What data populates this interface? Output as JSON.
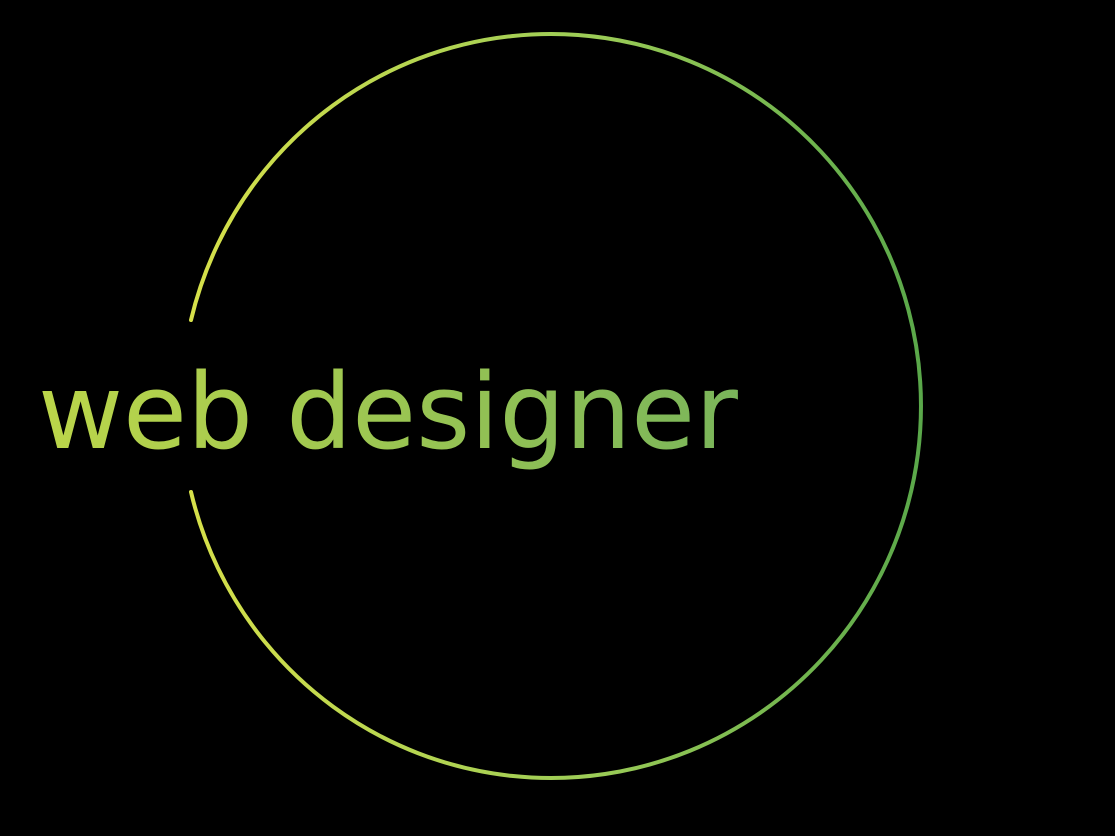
{
  "logo": {
    "text": "web designer",
    "gradient_start_color": "#d6e04a",
    "gradient_mid_color": "#9ccc57",
    "gradient_end_color": "#5aa84a",
    "text_start_color": "#bcd64a",
    "text_end_color": "#7ab55a",
    "background_color": "#000000"
  }
}
